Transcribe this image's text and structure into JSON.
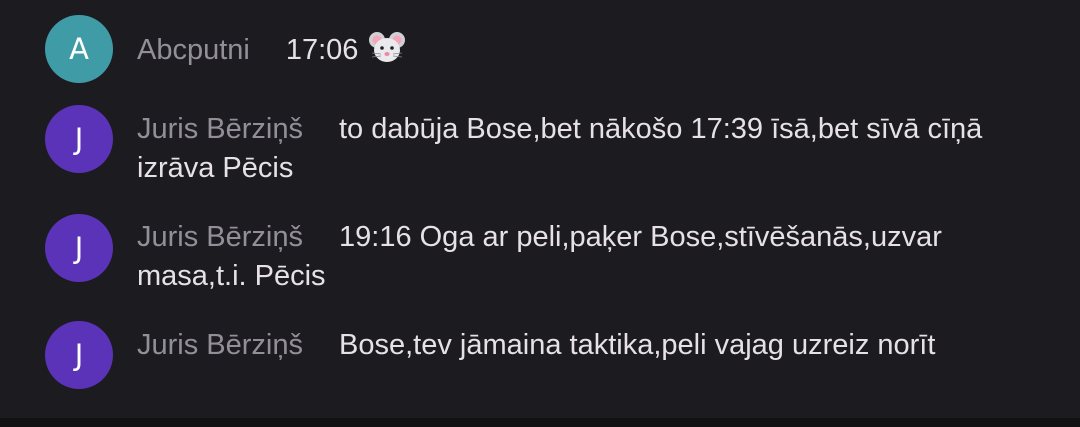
{
  "comments": [
    {
      "avatar_letter": "A",
      "author": "Abcputni",
      "message": "17:06",
      "emoji_icon": "mouse-face-icon",
      "avatar_color": "#3f9ca7"
    },
    {
      "avatar_letter": "J",
      "author": "Juris Bērziņš",
      "message": "to dabūja Bose,bet nākošo 17:39 īsā,bet sīvā cīņā izrāva Pēcis",
      "avatar_color": "#5b33b8"
    },
    {
      "avatar_letter": "J",
      "author": "Juris Bērziņš",
      "message": "19:16 Oga ar peli,paķer Bose,stīvēšanās,uzvar masa,t.i. Pēcis",
      "avatar_color": "#5b33b8"
    },
    {
      "avatar_letter": "J",
      "author": "Juris Bērziņš",
      "message": "Bose,tev jāmaina taktika,peli vajag uzreiz norīt",
      "avatar_color": "#5b33b8"
    }
  ]
}
